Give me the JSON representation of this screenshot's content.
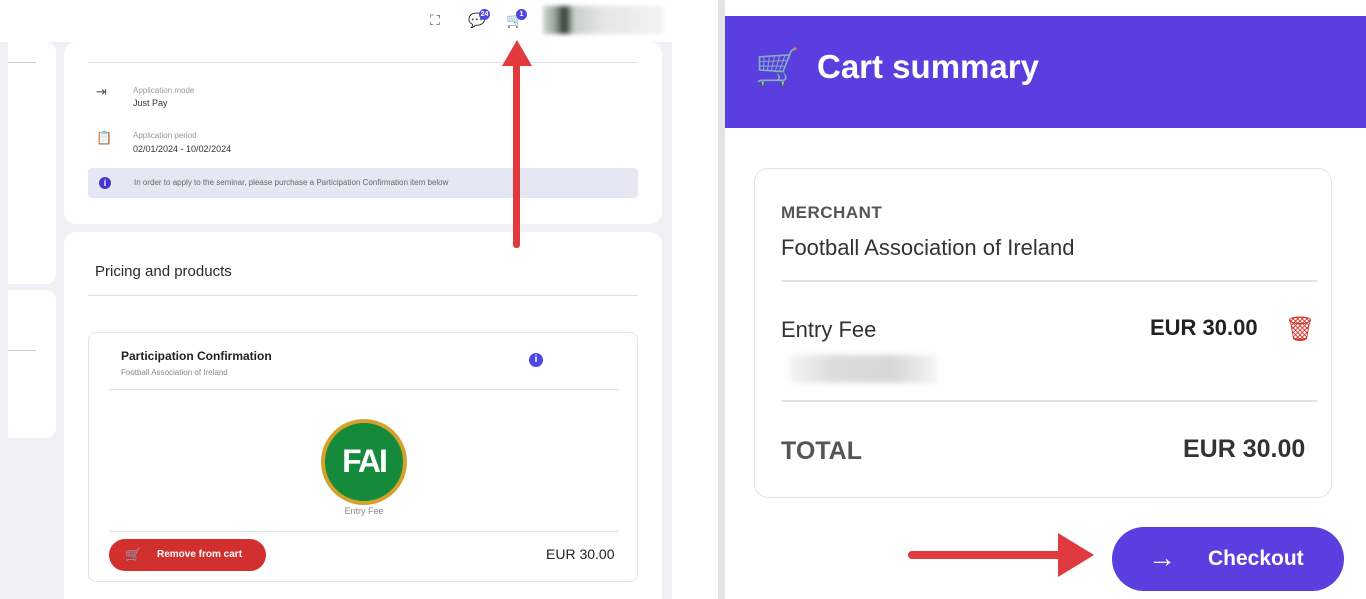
{
  "left_panel": {
    "topbar": {
      "fullscreen_icon": "expand-icon",
      "notifications_badge": "24",
      "cart_badge": "1"
    },
    "application_mode": {
      "label": "Application mode",
      "value": "Just Pay"
    },
    "application_period": {
      "label": "Application period",
      "value": "02/01/2024 - 10/02/2024"
    },
    "info_message": "In order to apply to the seminar, please purchase a Participation Confirmation item below",
    "pricing_section_title": "Pricing and products",
    "product": {
      "title": "Participation Confirmation",
      "merchant": "Football Association of Ireland",
      "logo_text": "FAI",
      "item_label": "Entry Fee",
      "remove_label": "Remove from cart",
      "price": "EUR 30.00"
    }
  },
  "cart_summary": {
    "title": "Cart summary",
    "merchant_label": "MERCHANT",
    "merchant_name": "Football Association of Ireland",
    "item_name": "Entry Fee",
    "item_price": "EUR 30.00",
    "total_label": "TOTAL",
    "total_value": "EUR 30.00",
    "checkout_label": "Checkout"
  },
  "colors": {
    "accent": "#5b3ee0",
    "danger": "#d2302f",
    "annotation_arrow": "#e0393e"
  }
}
